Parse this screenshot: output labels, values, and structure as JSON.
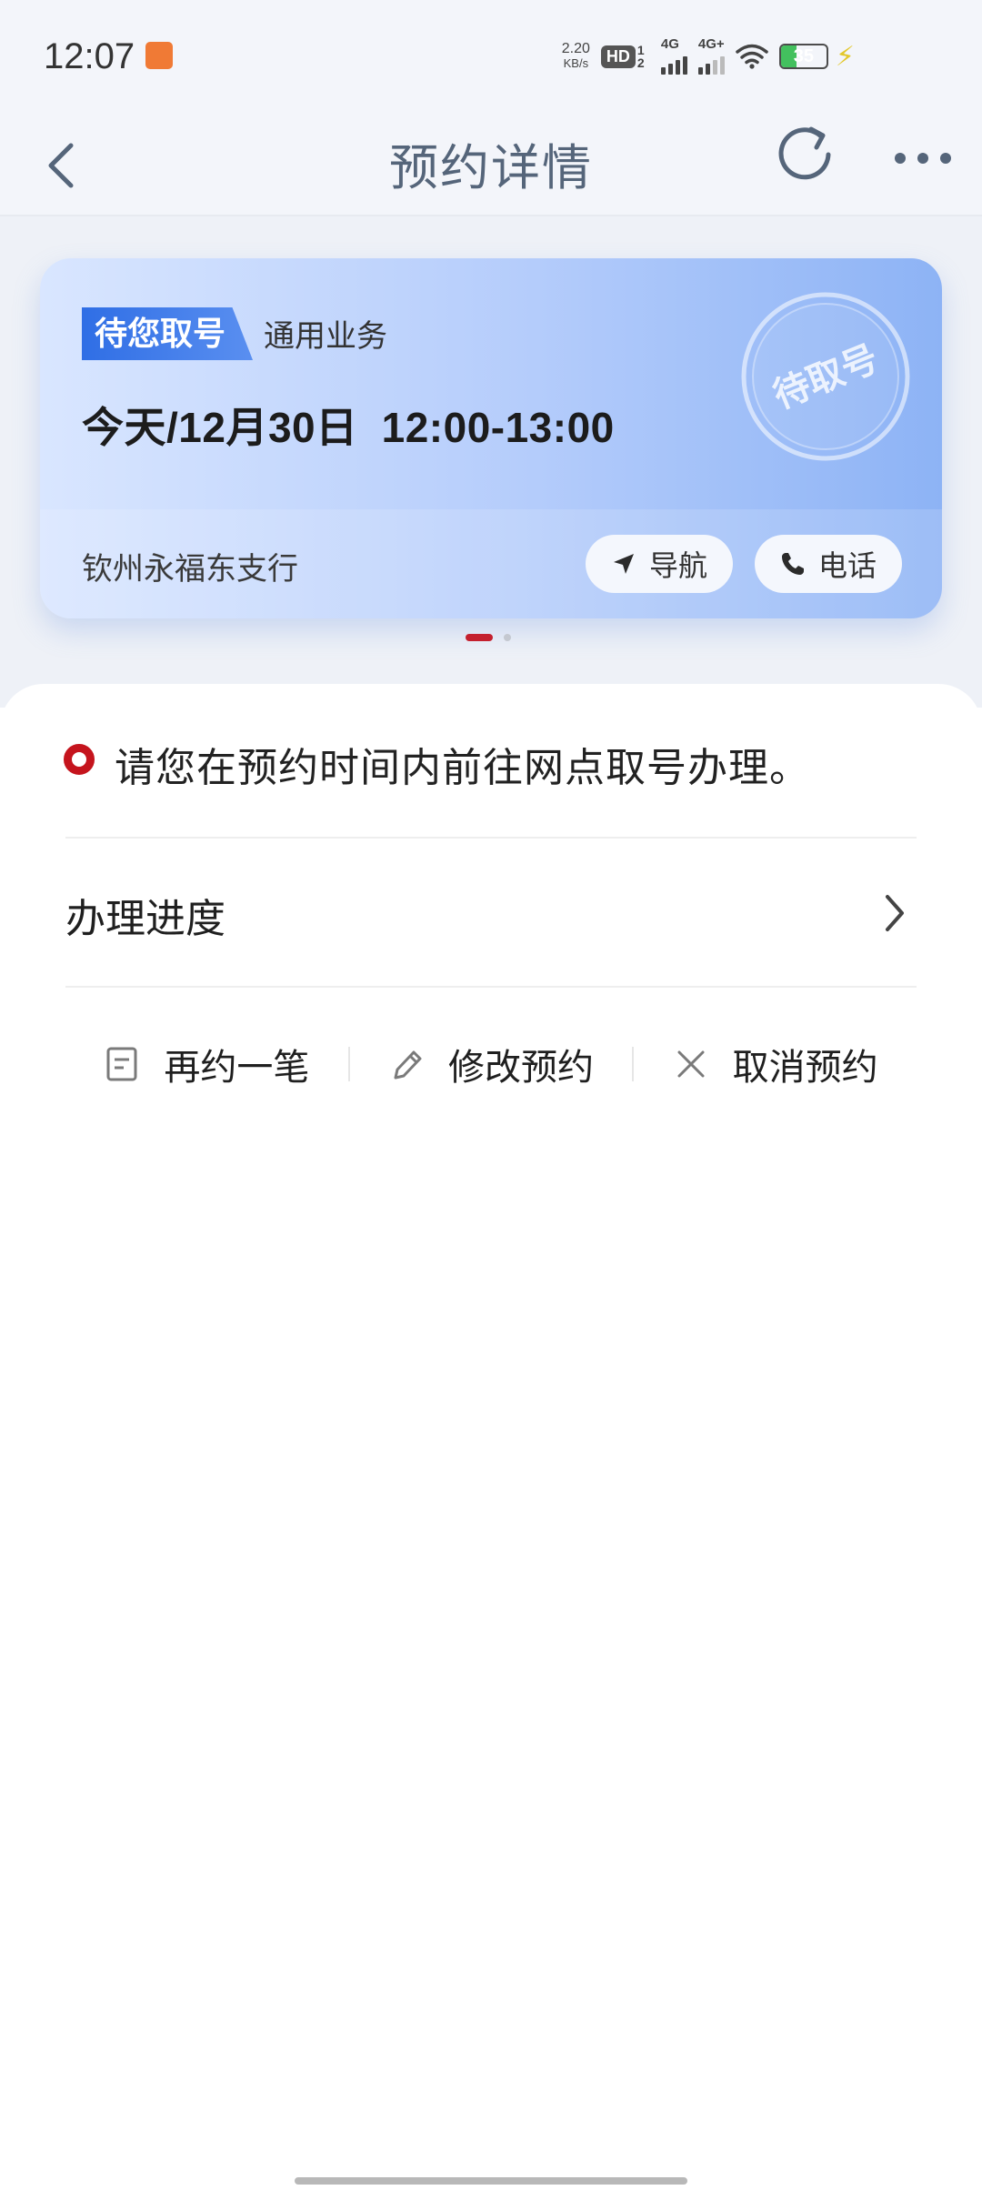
{
  "status_bar": {
    "time": "12:07",
    "net_speed_value": "2.20",
    "net_speed_unit": "KB/s",
    "hd_label": "HD",
    "hd_sub": "1 2",
    "signal1_label": "4G",
    "signal2_label": "4G+",
    "battery": "35",
    "battery_level": 0.35,
    "battery_color": "#43c05e"
  },
  "header": {
    "title": "预约详情",
    "icons": [
      "back-arrow-icon",
      "refresh-icon",
      "more-icon"
    ]
  },
  "card": {
    "status_tag": "待您取号",
    "business_type": "通用业务",
    "date_label": "今天/12月30日",
    "time_range": "12:00-13:00",
    "stamp_text": "待取号",
    "branch_name": "钦州永福东支行",
    "nav_label": "导航",
    "phone_label": "电话",
    "accent_color": "#2f6ee5"
  },
  "pager": {
    "total": 2,
    "active": 1,
    "active_color": "#c4202e"
  },
  "notice": {
    "text": "请您在预约时间内前往网点取号办理。",
    "icon_color": "#c5141d"
  },
  "progress": {
    "label": "办理进度"
  },
  "actions": [
    {
      "label": "再约一笔",
      "icon": "document-icon"
    },
    {
      "label": "修改预约",
      "icon": "pencil-icon"
    },
    {
      "label": "取消预约",
      "icon": "close-icon"
    }
  ]
}
